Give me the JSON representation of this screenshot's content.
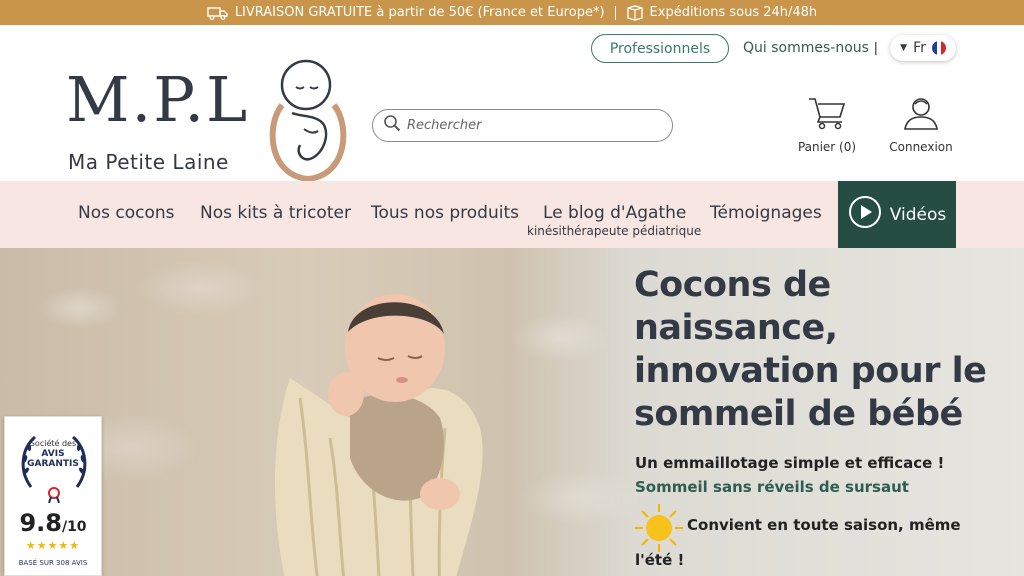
{
  "topbar": {
    "delivery_icon": "truck-icon",
    "delivery_text": "LIVRAISON GRATUITE à partir de 50€ (France et Europe*)",
    "shipping_icon": "package-icon",
    "shipping_text": "Expéditions sous 24h/48h",
    "color": "#c8954a"
  },
  "header": {
    "logo_letters": "M.P.L",
    "logo_name": "Ma Petite Laine",
    "professionals_label": "Professionnels",
    "about_label": "Qui sommes-nous",
    "about_separator": "|",
    "language_label": "Fr",
    "search_placeholder": "Rechercher",
    "cart_label": "Panier (0)",
    "login_label": "Connexion"
  },
  "nav": {
    "items": [
      {
        "label": "Nos cocons"
      },
      {
        "label": "Nos kits à tricoter"
      },
      {
        "label": "Tous nos produits"
      },
      {
        "label": "Le blog d'Agathe"
      },
      {
        "label": "Témoignages"
      }
    ],
    "blog_subtitle": "kinésithérapeute pédiatrique",
    "video_label": "Vidéos",
    "background": "#f8e6e3",
    "video_background": "#254d42"
  },
  "hero": {
    "title": "Cocons de naissance, innovation pour le sommeil de bébé",
    "line1": "Un emmaillotage simple et efficace !",
    "line2": "Sommeil sans réveils de sursaut",
    "line3a": "Convient en toute saison, même",
    "line3b": "l'été !",
    "sun_icon": "sun-icon"
  },
  "avis": {
    "small": "Société des",
    "big_line1": "AVIS",
    "big_line2": "GARANTIS",
    "score": "9.8",
    "score_suffix": "/10",
    "stars": "★★★★★",
    "count": "BASÉ SUR 308 AVIS"
  }
}
